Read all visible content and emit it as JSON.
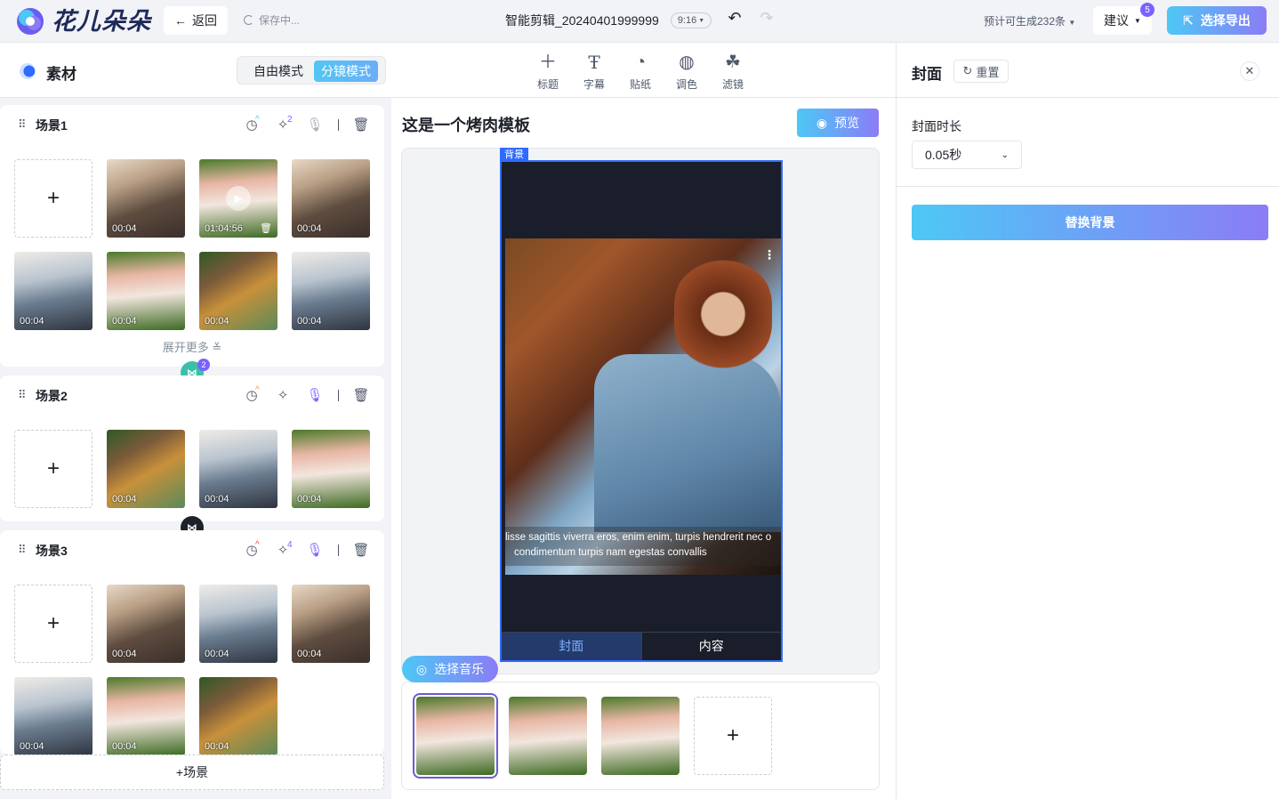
{
  "app": {
    "logo_text": "花儿朵朵"
  },
  "topbar": {
    "back_label": "返回",
    "saving_label": "保存中...",
    "doc_title": "智能剪辑_20240401999999",
    "ratio": "9:16",
    "estimate": "预计可生成232条",
    "suggest_label": "建议",
    "suggest_badge": "5",
    "export_label": "选择导出"
  },
  "left": {
    "title": "素材",
    "mode_free": "自由模式",
    "mode_scene": "分镜模式",
    "expand_label": "展开更多",
    "add_scene_label": "+场景",
    "connector1_badge": "2",
    "scenes": [
      {
        "name": "场景1",
        "badge_fx": "2",
        "thumbs": [
          {
            "dur": "00:04"
          },
          {
            "dur": "01:04:56"
          },
          {
            "dur": "00:04"
          },
          {
            "dur": "00:04"
          },
          {
            "dur": "00:04"
          },
          {
            "dur": "00:04"
          },
          {
            "dur": "00:04"
          }
        ]
      },
      {
        "name": "场景2",
        "thumbs": [
          {
            "dur": "00:04"
          },
          {
            "dur": "00:04"
          },
          {
            "dur": "00:04"
          }
        ]
      },
      {
        "name": "场景3",
        "badge_fx": "4",
        "thumbs": [
          {
            "dur": "00:04"
          },
          {
            "dur": "00:04"
          },
          {
            "dur": "00:04"
          },
          {
            "dur": "00:04"
          },
          {
            "dur": "00:04"
          },
          {
            "dur": "00:04"
          }
        ]
      }
    ]
  },
  "toolbar": {
    "tools": [
      {
        "label": "标题",
        "icon": "plus-icon"
      },
      {
        "label": "字幕",
        "icon": "text-icon"
      },
      {
        "label": "贴纸",
        "icon": "sticker-icon"
      },
      {
        "label": "调色",
        "icon": "palette-icon"
      },
      {
        "label": "滤镜",
        "icon": "filter-icon"
      }
    ]
  },
  "center": {
    "template_title": "这是一个烤肉模板",
    "preview_label": "预览",
    "bg_tag": "背景",
    "caption_line1": "lisse sagittis viverra eros, enim enim, turpis hendrerit nec o",
    "caption_line2": "condimentum turpis nam egestas convallis",
    "tab_cover": "封面",
    "tab_content": "内容",
    "music_label": "选择音乐"
  },
  "right": {
    "title": "封面",
    "reset_label": "重置",
    "duration_label": "封面时长",
    "duration_value": "0.05秒",
    "replace_label": "替换背景"
  },
  "colors": {
    "accent_start": "#4dc8f5",
    "accent_end": "#8b7cf6",
    "selection": "#2f6bff",
    "badge": "#7b61ff"
  }
}
